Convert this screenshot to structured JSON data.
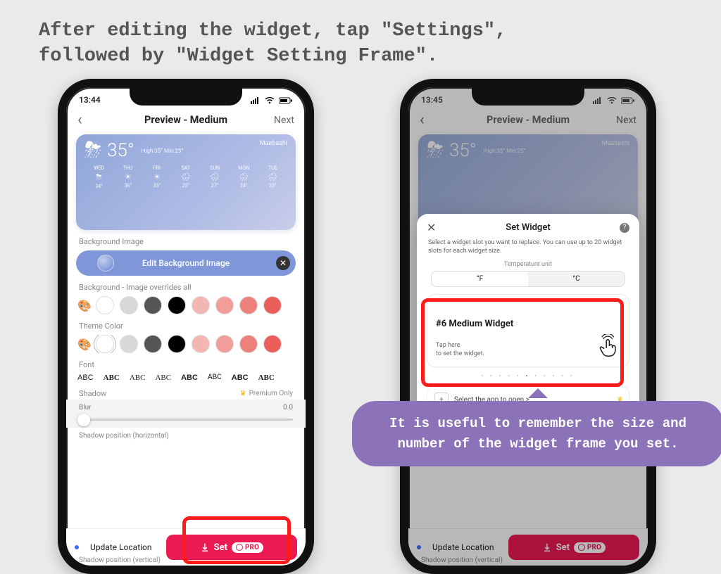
{
  "instruction_line1": "After editing the widget, tap \"Settings\",",
  "instruction_line2": "followed by \"Widget Setting Frame\".",
  "tip_text": "It is useful to remember the size and number of the widget frame you set.",
  "phone_left": {
    "time": "13:44",
    "nav_back_glyph": "‹",
    "nav_title": "Preview - Medium",
    "nav_next": "Next",
    "weather": {
      "temp": "35°",
      "highlow": "High:35° Min:25°",
      "city": "Maebashi",
      "forecast": [
        {
          "d": "WED",
          "t": "34°"
        },
        {
          "d": "THU",
          "t": "36°"
        },
        {
          "d": "FRI",
          "t": "35°"
        },
        {
          "d": "SAT",
          "t": "25°"
        },
        {
          "d": "SUN",
          "t": "27°"
        },
        {
          "d": "MON",
          "t": "24°"
        },
        {
          "d": "TUE",
          "t": "23°"
        }
      ]
    },
    "label_bgimg": "Background Image",
    "btn_editbg": "Edit Background Image",
    "label_bg_override": "Background - Image overrides all",
    "label_theme": "Theme Color",
    "label_font": "Font",
    "fonts": [
      "ABC",
      "ABC",
      "ABC",
      "ABC",
      "ABC",
      "ABC",
      "ABC",
      "ABC"
    ],
    "label_shadow": "Shadow",
    "premium_only": "Premium Only",
    "label_blur": "Blur",
    "blur_value": "0.0",
    "label_shadow_h": "Shadow position (horizontal)",
    "label_shadow_v": "Shadow position (vertical)",
    "btn_update_loc": "Update Location",
    "btn_set": "Set",
    "btn_pro": "PRO",
    "bg_colors": [
      "#ffffff",
      "#d8d8d8",
      "#555555",
      "#000000",
      "#f3b6b3",
      "#f19d9a",
      "#ee807c",
      "#ea5f59"
    ],
    "theme_colors": [
      "#ffffff",
      "#d8d8d8",
      "#555555",
      "#000000",
      "#f3b6b3",
      "#f19d9a",
      "#ee807c",
      "#ea5f59"
    ]
  },
  "phone_right": {
    "time": "13:45",
    "nav_title": "Preview - Medium",
    "nav_next": "Next",
    "sheet": {
      "title": "Set Widget",
      "desc": "Select a widget slot you want to replace. You can use up to 20 widget slots for each widget size.",
      "tunit_label": "Temperature unit",
      "seg_f": "°F",
      "seg_c": "°C",
      "slot_name": "#6 Medium Widget",
      "slot_tap1": "Tap here",
      "slot_tap2": "to set the widget.",
      "openapp": "Select the app to open >"
    }
  }
}
